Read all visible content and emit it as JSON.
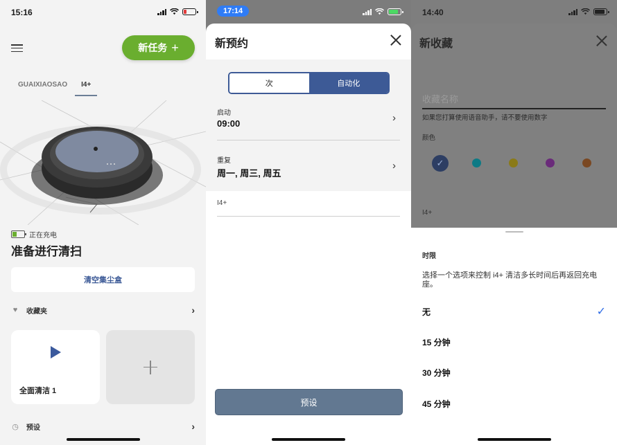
{
  "screen1": {
    "status_time": "15:16",
    "new_task_label": "新任务",
    "robots": [
      "GUAIXIAOSAO",
      "I4+"
    ],
    "charging_text": "正在充电",
    "ready_text": "准备进行清扫",
    "empty_bin_label": "清空集尘盒",
    "favorites_label": "收藏夹",
    "favorite_card_label": "全面清洁 1",
    "presets_label": "预设"
  },
  "screen2": {
    "status_time": "17:14",
    "title": "新预约",
    "segments": [
      "次",
      "自动化"
    ],
    "start_label": "启动",
    "start_value": "09:00",
    "repeat_label": "重复",
    "repeat_value": "周一, 周三, 周五",
    "robot_name": "I4+",
    "preset_button": "预设"
  },
  "screen3": {
    "status_time": "14:40",
    "title": "新收藏",
    "name_placeholder": "收藏名称",
    "hint": "如果您打算使用语音助手，请不要使用数字",
    "color_label": "颜色",
    "colors": [
      "#2d3e63",
      "#0d7a85",
      "#8a7a18",
      "#6a2b7a",
      "#7a4822"
    ],
    "robot_name": "I4+",
    "limit_heading": "时限",
    "limit_description": "选择一个选项来控制 i4+ 清洁多长时间后再返回充电座。",
    "options": [
      "无",
      "15 分钟",
      "30 分钟",
      "45 分钟"
    ],
    "selected_option": "无"
  }
}
